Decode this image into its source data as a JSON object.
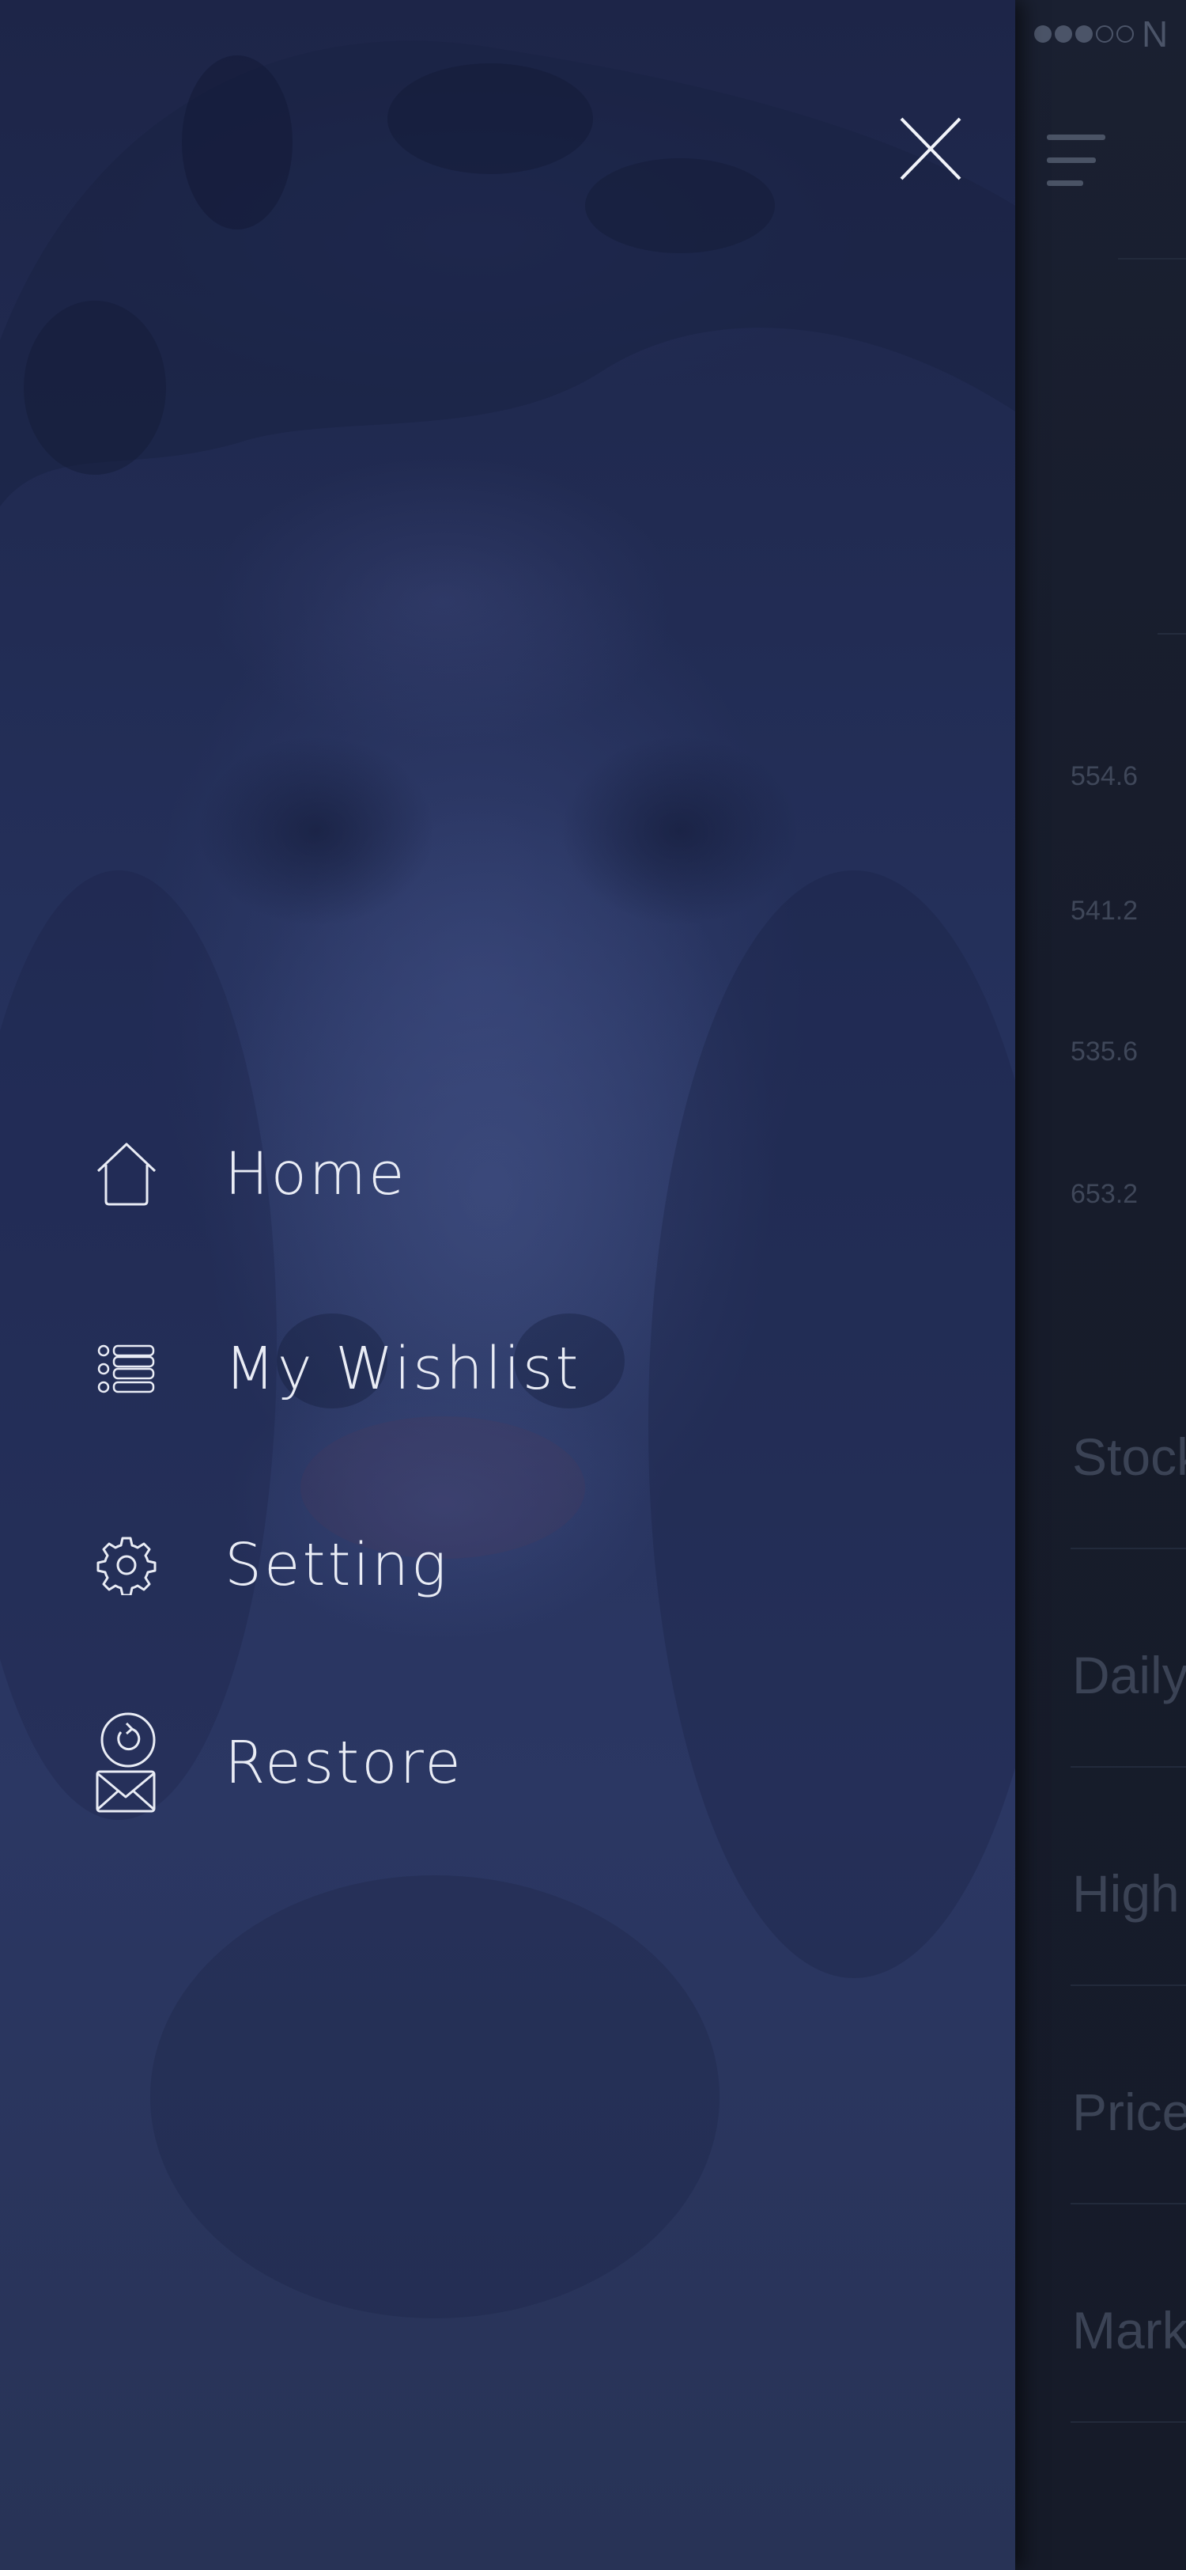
{
  "status_bar": {
    "carrier": "N",
    "signal_filled": 3,
    "signal_total": 5
  },
  "underlying_screen": {
    "prices": [
      "554.6",
      "541.2",
      "535.6",
      "653.2"
    ],
    "row_labels": [
      "Stock",
      "Daily",
      "High",
      "Price",
      "Marke"
    ]
  },
  "drawer": {
    "close_icon": "close-icon",
    "menu": [
      {
        "label": "Home",
        "icon": "home-icon"
      },
      {
        "label": "My Wishlist",
        "icon": "list-icon"
      },
      {
        "label": "Setting",
        "icon": "gear-icon"
      },
      {
        "label": "Restore",
        "icon": "restore-icon"
      }
    ]
  },
  "colors": {
    "drawer_bg": "#25315c",
    "menu_text": "#e9ecf5",
    "underlay_bg": "#171c2b",
    "underlay_text": "#3b4355"
  }
}
